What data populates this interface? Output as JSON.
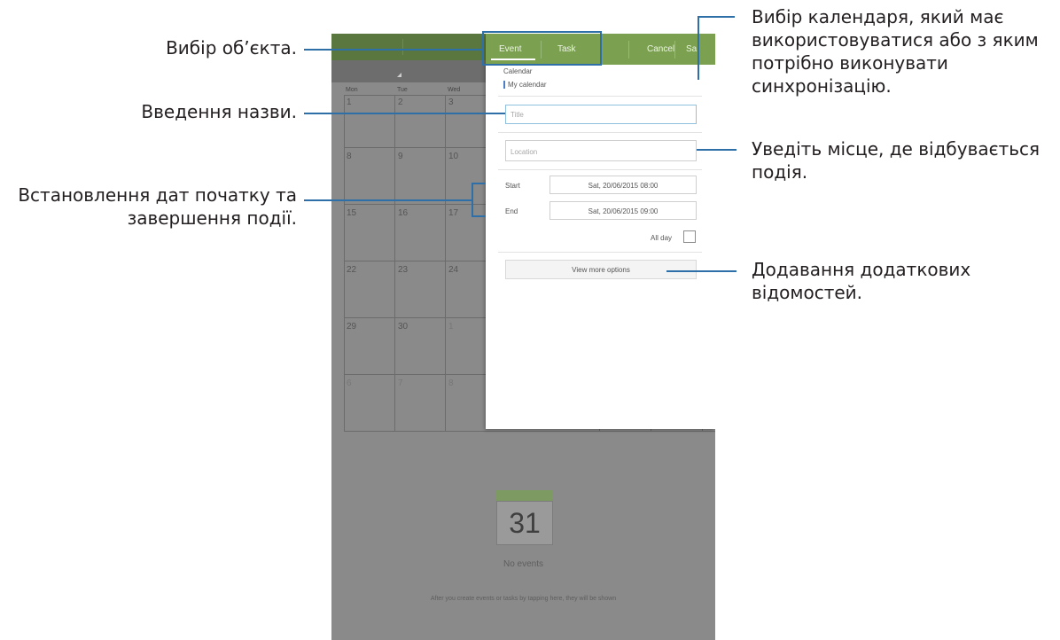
{
  "annotations": {
    "object_select": "Вибір об’єкта.",
    "name_entry": "Введення назви.",
    "dates_line1": "Встановлення дат початку та",
    "dates_line2": "завершення події.",
    "calendar_line1": "Вибір календаря, який має",
    "calendar_line2": "використовуватися або з яким",
    "calendar_line3": "потрібно виконувати",
    "calendar_line4": "синхронізацію.",
    "location_line1": "Уведіть місце, де відбувається",
    "location_line2": "подія.",
    "more_line1": "Додавання додаткових",
    "more_line2": "відомостей."
  },
  "calendar": {
    "weekdays": [
      "Mon",
      "Tue",
      "Wed"
    ],
    "rows": [
      [
        "1",
        "2",
        "3"
      ],
      [
        "8",
        "9",
        "10"
      ],
      [
        "15",
        "16",
        "17"
      ],
      [
        "22",
        "23",
        "24"
      ],
      [
        "29",
        "30",
        "1"
      ],
      [
        "6",
        "7",
        "8"
      ]
    ]
  },
  "panel": {
    "tab_event": "Event",
    "tab_task": "Task",
    "cancel": "Cancel",
    "save": "Sa",
    "calendar_label": "Calendar",
    "calendar_value": "My calendar",
    "title_placeholder": "Title",
    "location_placeholder": "Location",
    "start_label": "Start",
    "start_value": "Sat, 20/06/2015  08:00",
    "end_label": "End",
    "end_value": "Sat, 20/06/2015  09:00",
    "allday_label": "All day",
    "more_options": "View more options"
  },
  "empty_state": {
    "day": "31",
    "no_events": "No events",
    "hint": "After you create events or tasks by tapping here, they will be shown"
  },
  "colors": {
    "accent_green": "#7aa050",
    "callout_blue": "#2d6fa6",
    "overlay_gray": "#8a8a8a"
  }
}
